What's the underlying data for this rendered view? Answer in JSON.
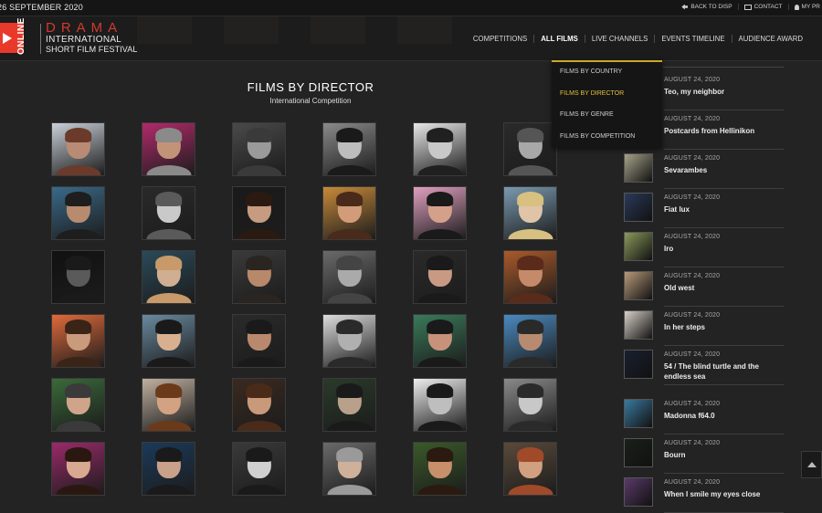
{
  "topbar": {
    "date": "26 SEPTEMBER 2020",
    "back": "BACK TO DISP",
    "contact": "CONTACT",
    "my": "MY PR"
  },
  "logo": {
    "online": "ONLINE",
    "drama": "DRAMA",
    "line1": "INTERNATIONAL",
    "line2": "SHORT FILM FESTIVAL"
  },
  "nav": [
    "COMPETITIONS",
    "ALL FILMS",
    "LIVE CHANNELS",
    "EVENTS TIMELINE",
    "AUDIENCE AWARD"
  ],
  "dropdown": [
    "FILMS BY COUNTRY",
    "FILMS BY DIRECTOR",
    "FILMS BY GENRE",
    "FILMS BY COMPETITION"
  ],
  "main": {
    "title": "FILMS BY DIRECTOR",
    "subtitle": "International Competition"
  },
  "directors": [
    [
      "#b98a74",
      "#6b3a2a",
      "#c9d0d8"
    ],
    [
      "#c39378",
      "#8a8a8a",
      "#b22a6b"
    ],
    [
      "#9a9a9a",
      "#3a3a3a",
      "#4a4a4a"
    ],
    [
      "#bdbdbd",
      "#1a1a1a",
      "#8a8a8a"
    ],
    [
      "#c8c8c8",
      "#202020",
      "#e8e8e8"
    ],
    [
      "#a8a8a8",
      "#555555",
      "#2a2a2a"
    ],
    [
      "#b88a6e",
      "#1e1e1e",
      "#3a6a8a"
    ],
    [
      "#c9c9c9",
      "#5a5a5a",
      "#2a2a2a"
    ],
    [
      "#c69b80",
      "#2a1a12",
      "#1a1a1a"
    ],
    [
      "#d29c7a",
      "#4a2a1a",
      "#c88a3a"
    ],
    [
      "#d5a08a",
      "#1a1a1a",
      "#e0a0c0"
    ],
    [
      "#e0c4a8",
      "#d8c080",
      "#7a9ab0"
    ],
    [
      "#5a5a5a",
      "#1a1a1a",
      "#111111"
    ],
    [
      "#d0ae92",
      "#c89a6a",
      "#2a4a5a"
    ],
    [
      "#b8886a",
      "#2a2520",
      "#3a3a3a"
    ],
    [
      "#aaaaaa",
      "#444444",
      "#6a6a6a"
    ],
    [
      "#c89a84",
      "#1a1a1a",
      "#2a2a2a"
    ],
    [
      "#c48a6a",
      "#5a2a1a",
      "#aa5a2a"
    ],
    [
      "#c99a7c",
      "#3a2418",
      "#e06a3a"
    ],
    [
      "#d8b090",
      "#1a1a1a",
      "#6a8aa0"
    ],
    [
      "#b9896e",
      "#1a1a1a",
      "#2a2a2a"
    ],
    [
      "#b0b0b0",
      "#2a2a2a",
      "#dddddd"
    ],
    [
      "#c8927a",
      "#1a1a1a",
      "#3a7a5a"
    ],
    [
      "#b88a70",
      "#2a2a2a",
      "#4a8ac0"
    ],
    [
      "#d0a48a",
      "#3a3a3a",
      "#3a6a3a"
    ],
    [
      "#d2a282",
      "#6a3a1a",
      "#c0b0a0"
    ],
    [
      "#c89a7a",
      "#4a2a18",
      "#3a2a20"
    ],
    [
      "#b9a08a",
      "#1a1a1a",
      "#2a3a2a"
    ],
    [
      "#bebebe",
      "#1a1a1a",
      "#eeeeee"
    ],
    [
      "#c8c8c8",
      "#2a2a2a",
      "#8a8a8a"
    ],
    [
      "#d8a890",
      "#2a1810",
      "#9a2a6a"
    ],
    [
      "#c9a08a",
      "#1a1a1a",
      "#1a3a5a"
    ],
    [
      "#d0d0d0",
      "#1a1a1a",
      "#3a3a3a"
    ],
    [
      "#cfb09a",
      "#9a9a9a",
      "#6a6a6a"
    ],
    [
      "#c8906a",
      "#2a1a10",
      "#3a5a2a"
    ],
    [
      "#d0a080",
      "#a04a2a",
      "#5a4a3a"
    ]
  ],
  "films": [
    {
      "date": "AUGUST 24, 2020",
      "title": "Teo, my neighbor",
      "thumb": "#2e2e2e"
    },
    {
      "date": "AUGUST 24, 2020",
      "title": "Postcards from Hellinikon",
      "thumb": "#3a3632"
    },
    {
      "date": "AUGUST 24, 2020",
      "title": "Sevarambes",
      "thumb": "#a8a48a"
    },
    {
      "date": "AUGUST 24, 2020",
      "title": "Fiat lux",
      "thumb": "#2a3a5a"
    },
    {
      "date": "AUGUST 24, 2020",
      "title": "Iro",
      "thumb": "#8a9a5a"
    },
    {
      "date": "AUGUST 24, 2020",
      "title": "Old west",
      "thumb": "#b89a7a"
    },
    {
      "date": "AUGUST 24, 2020",
      "title": "In her steps",
      "thumb": "#d8d0c8"
    },
    {
      "date": "AUGUST 24, 2020",
      "title": "54 / The blind turtle and the endless sea",
      "thumb": "#1a2030"
    },
    {
      "date": "AUGUST 24, 2020",
      "title": "Madonna f64.0",
      "thumb": "#3a7aa0"
    },
    {
      "date": "AUGUST 24, 2020",
      "title": "Bourn",
      "thumb": "#1a201a"
    },
    {
      "date": "AUGUST 24, 2020",
      "title": "When I smile my eyes close",
      "thumb": "#5a3a6a"
    }
  ]
}
